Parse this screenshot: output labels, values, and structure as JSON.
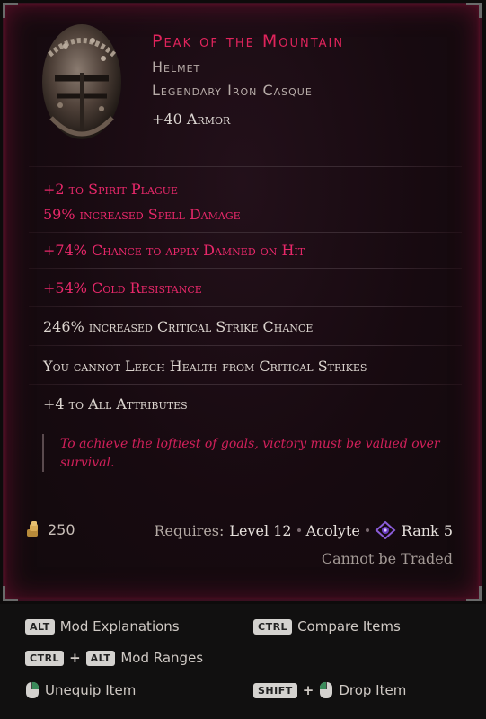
{
  "item": {
    "name": "Peak of the Mountain",
    "type": "Helmet",
    "base": "Legendary Iron Casque",
    "implicit": "+40 Armor"
  },
  "mods": [
    "+2 to Spirit Plague",
    "59% increased Spell Damage",
    "+74% Chance to apply Damned on Hit",
    "+54% Cold Resistance",
    "246% increased Critical Strike Chance",
    "You cannot Leech Health from Critical Strikes",
    "+4 to All Attributes"
  ],
  "flavor": "To achieve the loftiest of goals, victory must be valued over survival.",
  "footer": {
    "gold": "250",
    "requires_label": "Requires:",
    "level": "Level 12",
    "class": "Acolyte",
    "rank": "Rank 5",
    "trade": "Cannot be Traded"
  },
  "controls": {
    "mod_explanations": {
      "keys": [
        "ALT"
      ],
      "label": "Mod Explanations"
    },
    "compare_items": {
      "keys": [
        "CTRL"
      ],
      "label": "Compare Items"
    },
    "mod_ranges": {
      "keys": [
        "CTRL",
        "ALT"
      ],
      "label": "Mod Ranges"
    },
    "unequip": {
      "label": "Unequip Item"
    },
    "drop": {
      "keys": [
        "SHIFT"
      ],
      "label": "Drop Item"
    }
  },
  "colors": {
    "legendary": "#e0245c",
    "affix": "#e8286a",
    "text": "#ddd6d0"
  },
  "icons": [
    "helmet-icon",
    "gold-icon",
    "rank-icon",
    "mouse-left-icon",
    "mouse-right-icon"
  ]
}
